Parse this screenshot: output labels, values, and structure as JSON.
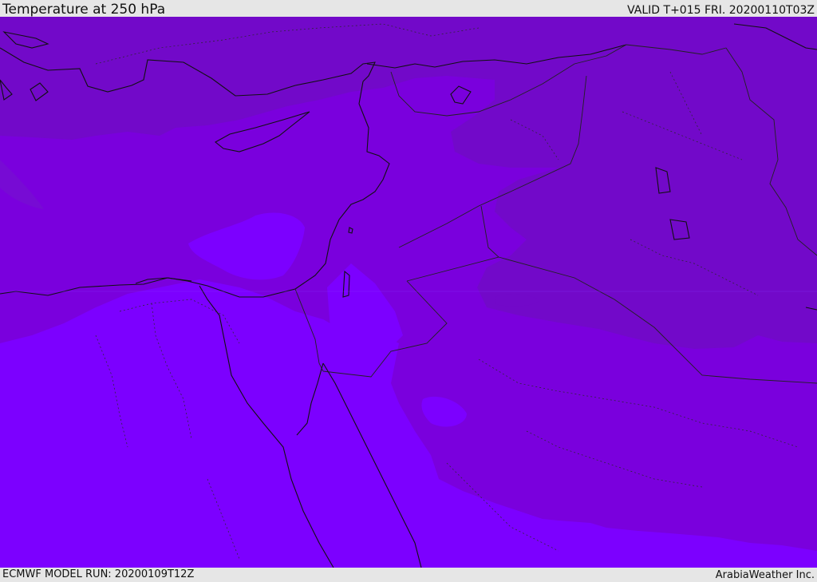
{
  "header": {
    "title": "Temperature at 250 hPa",
    "valid": "VALID T+015 FRI. 20200110T03Z"
  },
  "footer": {
    "model_run": "ECMWF MODEL RUN: 20200109T12Z",
    "credit": "ArabiaWeather Inc."
  },
  "colors": {
    "cold": "#7209c9",
    "mid": "#7a00dd",
    "warm": "#7c00ff",
    "coast": "#111111",
    "border": "#222222"
  }
}
